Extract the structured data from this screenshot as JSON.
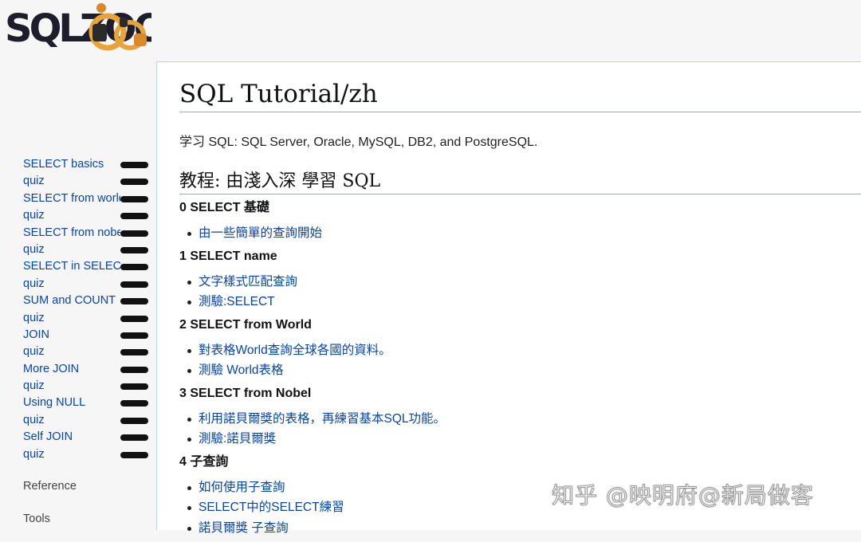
{
  "logo": {
    "text": "SQLZOO"
  },
  "sidebar": {
    "items": [
      {
        "label": "SELECT basics"
      },
      {
        "label": "quiz"
      },
      {
        "label": "SELECT from world"
      },
      {
        "label": "quiz"
      },
      {
        "label": "SELECT from nobel"
      },
      {
        "label": "quiz"
      },
      {
        "label": "SELECT in SELECT"
      },
      {
        "label": "quiz"
      },
      {
        "label": "SUM and COUNT"
      },
      {
        "label": "quiz"
      },
      {
        "label": "JOIN"
      },
      {
        "label": "quiz"
      },
      {
        "label": "More JOIN"
      },
      {
        "label": "quiz"
      },
      {
        "label": "Using NULL"
      },
      {
        "label": "quiz"
      },
      {
        "label": "Self JOIN"
      },
      {
        "label": "quiz"
      }
    ],
    "reference": "Reference",
    "tools": "Tools"
  },
  "main": {
    "title": "SQL Tutorial/zh",
    "intro": "学习 SQL: SQL Server, Oracle, MySQL, DB2, and PostgreSQL.",
    "section_heading": "教程: 由淺入深 學習 SQL",
    "lessons": [
      {
        "title": "0 SELECT 基礎",
        "links": [
          "由一些簡單的查詢開始"
        ]
      },
      {
        "title": "1 SELECT name",
        "links": [
          "文字樣式匹配查詢",
          "測驗:SELECT"
        ]
      },
      {
        "title": "2 SELECT from World",
        "links": [
          "對表格World查詢全球各國的資料。",
          "測驗 World表格"
        ]
      },
      {
        "title": "3 SELECT from Nobel",
        "links": [
          "利用諾貝爾獎的表格，再練習基本SQL功能。",
          "測驗:諾貝爾獎"
        ]
      },
      {
        "title": "4 子查詢",
        "links": [
          "如何使用子查詢",
          "SELECT中的SELECT練習",
          "諾貝爾獎 子查詢"
        ]
      }
    ]
  },
  "watermark": "知乎 @映明府@新局做客",
  "colors": {
    "link": "#0645ad",
    "sidebar_link": "#0b3f8a",
    "border": "#a7d7f9"
  }
}
